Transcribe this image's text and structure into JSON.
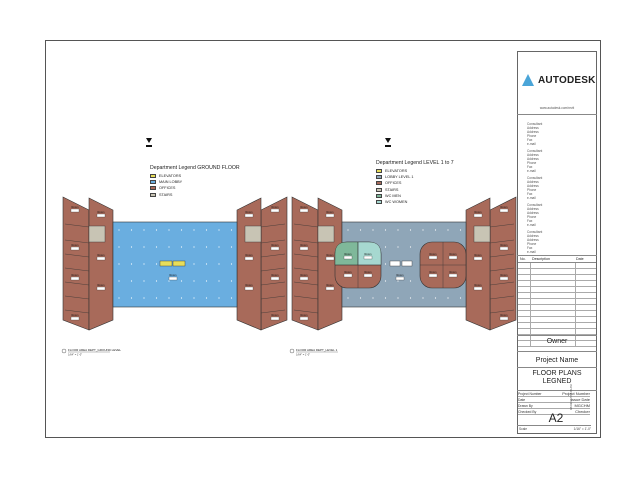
{
  "brand": {
    "logo_text": "AUTODESK",
    "url": "www.autodesk.com/revit"
  },
  "consultants": [
    {
      "lines": [
        "Consultant",
        "Address",
        "Address",
        "Phone",
        "Fax",
        "e-mail"
      ]
    },
    {
      "lines": [
        "Consultant",
        "Address",
        "Address",
        "Phone",
        "Fax",
        "e-mail"
      ]
    },
    {
      "lines": [
        "Consultant",
        "Address",
        "Address",
        "Phone",
        "Fax",
        "e-mail"
      ]
    },
    {
      "lines": [
        "Consultant",
        "Address",
        "Address",
        "Phone",
        "Fax",
        "e-mail"
      ]
    },
    {
      "lines": [
        "Consultant",
        "Address",
        "Address",
        "Phone",
        "Fax",
        "e-mail"
      ]
    }
  ],
  "revisions": {
    "headers": [
      "No.",
      "Description",
      "Date"
    ]
  },
  "title_block": {
    "owner": "Owner",
    "project_name": "Project Name",
    "sheet_title_1": "FLOOR PLANS",
    "sheet_title_2": "LEGNED",
    "fields": [
      {
        "label": "Project Number",
        "value": "Project Number"
      },
      {
        "label": "Date",
        "value": "Issue Date"
      },
      {
        "label": "Drawn By",
        "value": "MGCHM"
      },
      {
        "label": "Checked By",
        "value": "Checker"
      }
    ],
    "sheet_number": "A2",
    "scale_label": "Scale",
    "scale_value": "1/16\" = 1'-0\"",
    "side_date": "4/10/2015 5:55:09 AM"
  },
  "colors": {
    "office": "#a86a5a",
    "lobby_main": "#6aaee0",
    "lobby_level": "#8fa6b8",
    "elevator": "#e8de5a",
    "stairs": "#c8c4b4",
    "wc_men": "#7fb89a",
    "wc_women": "#a6d8d0"
  },
  "legends": [
    {
      "title": "Department Legend GROUND FLOOR",
      "items": [
        {
          "label": "ELEVATORS",
          "color": "#e8de5a"
        },
        {
          "label": "MAIN LOBBY",
          "color": "#6aaee0"
        },
        {
          "label": "OFFICES",
          "color": "#a86a5a"
        },
        {
          "label": "STAIRS",
          "color": "#c8c4b4"
        }
      ]
    },
    {
      "title": "Department Legend LEVEL 1 to 7",
      "items": [
        {
          "label": "ELEVATORS",
          "color": "#e8de5a"
        },
        {
          "label": "LOBBY LEVEL 1",
          "color": "#8fa6b8"
        },
        {
          "label": "OFFICES",
          "color": "#a86a5a"
        },
        {
          "label": "STAIRS",
          "color": "#c8c4b4"
        },
        {
          "label": "WC MEN",
          "color": "#7fb89a"
        },
        {
          "label": "WC WOMEN",
          "color": "#a6d8d0"
        }
      ]
    }
  ],
  "plans": [
    {
      "caption": "FLOOR AREA DEPT_GROUND LEVEL",
      "scale": "1/64\" = 1'-0\""
    },
    {
      "caption": "FLOOR AREA DEPT_LEVEL 1",
      "scale": "1/64\" = 1'-0\""
    }
  ],
  "room_label": "Room"
}
